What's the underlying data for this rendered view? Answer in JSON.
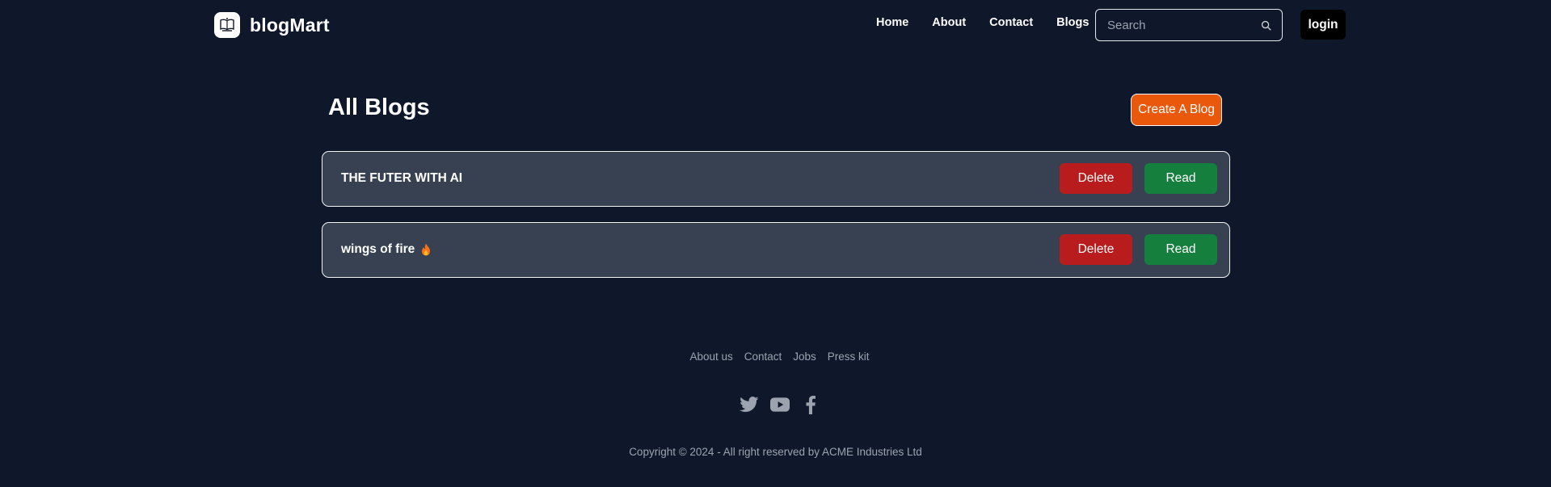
{
  "nav": {
    "brand_name": "blogMart",
    "links": [
      "Home",
      "About",
      "Contact",
      "Blogs"
    ],
    "search_placeholder": "Search",
    "login_label": "login"
  },
  "main": {
    "title": "All Blogs",
    "create_label": "Create A Blog",
    "blogs": [
      {
        "title": "THE FUTER WITH AI",
        "delete_label": "Delete",
        "read_label": "Read",
        "emoji": ""
      },
      {
        "title": "wings of fire",
        "delete_label": "Delete",
        "read_label": "Read",
        "emoji": "fire-icon"
      }
    ]
  },
  "footer": {
    "links": [
      "About us",
      "Contact",
      "Jobs",
      "Press kit"
    ],
    "social_icons": [
      "twitter-icon",
      "youtube-icon",
      "facebook-icon"
    ],
    "copyright": "Copyright © 2024 - All right reserved by ACME Industries Ltd"
  },
  "colors": {
    "background": "#0f172a",
    "card": "#374151",
    "accent": "#ea580c",
    "delete": "#b91c1c",
    "read": "#15803d",
    "muted": "#9ca3af"
  }
}
